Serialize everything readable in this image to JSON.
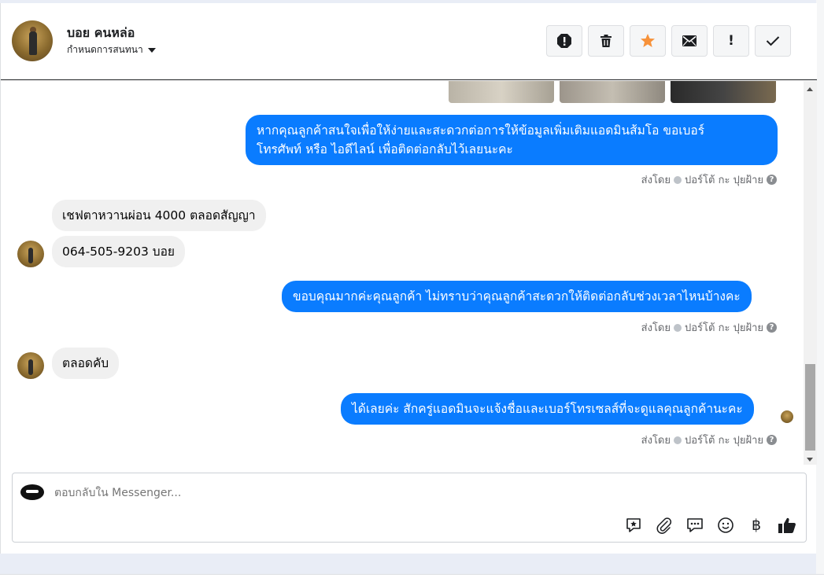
{
  "header": {
    "contact_name": "บอย คนหล่อ",
    "assign_label": "กำหนดการสนทนา",
    "actions": [
      {
        "name": "spam-icon"
      },
      {
        "name": "trash-icon"
      },
      {
        "name": "star-icon",
        "color": "#f7923a"
      },
      {
        "name": "envelope-icon"
      },
      {
        "name": "exclamation-icon",
        "label": "!"
      },
      {
        "name": "checkmark-icon"
      }
    ]
  },
  "messages": [
    {
      "type": "outgoing",
      "text_line1": "หากคุณลูกค้าสนใจเพื่อให้ง่ายและสะดวกต่อการให้ข้อมูลเพิ่มเติมแอดมินส้มโอ ขอเบอร์",
      "text_line2": "โทรศัพท์ หรือ ไอดีไลน์ เพื่อติดต่อกลับไว้เลยนะคะ",
      "sent_prefix": "ส่งโดย",
      "sent_by": "ปอร์โต้ กะ ปุยฝ้าย"
    },
    {
      "type": "incoming",
      "text": "เชฟตาหวานผ่อน 4000 ตลอดสัญญา"
    },
    {
      "type": "incoming",
      "text": "064-505-9203 บอย"
    },
    {
      "type": "outgoing",
      "text": "ขอบคุณมากค่ะคุณลูกค้า ไม่ทราบว่าคุณลูกค้าสะดวกให้ติดต่อกลับช่วงเวลาไหนบ้างคะ",
      "sent_prefix": "ส่งโดย",
      "sent_by": "ปอร์โต้ กะ ปุยฝ้าย"
    },
    {
      "type": "incoming",
      "text": "ตลอดคับ"
    },
    {
      "type": "outgoing",
      "text": "ได้เลยค่ะ สักครู่แอดมินจะแจ้งชื่อและเบอร์โทรเซลส์ที่จะดูแลคุณลูกค้านะคะ",
      "sent_prefix": "ส่งโดย",
      "sent_by": "ปอร์โต้ กะ ปุยฝ้าย"
    }
  ],
  "help_glyph": "?",
  "composer": {
    "placeholder": "ตอบกลับใน Messenger...",
    "tools": [
      "saved-reply-icon",
      "attachment-icon",
      "chat-bubbles-icon",
      "emoji-icon",
      "baht-icon",
      "thumbs-up-icon"
    ],
    "baht_symbol": "฿"
  },
  "colors": {
    "outgoing_bubble": "#0a7cff",
    "incoming_bubble": "#f0f0f0",
    "star": "#f7923a"
  }
}
